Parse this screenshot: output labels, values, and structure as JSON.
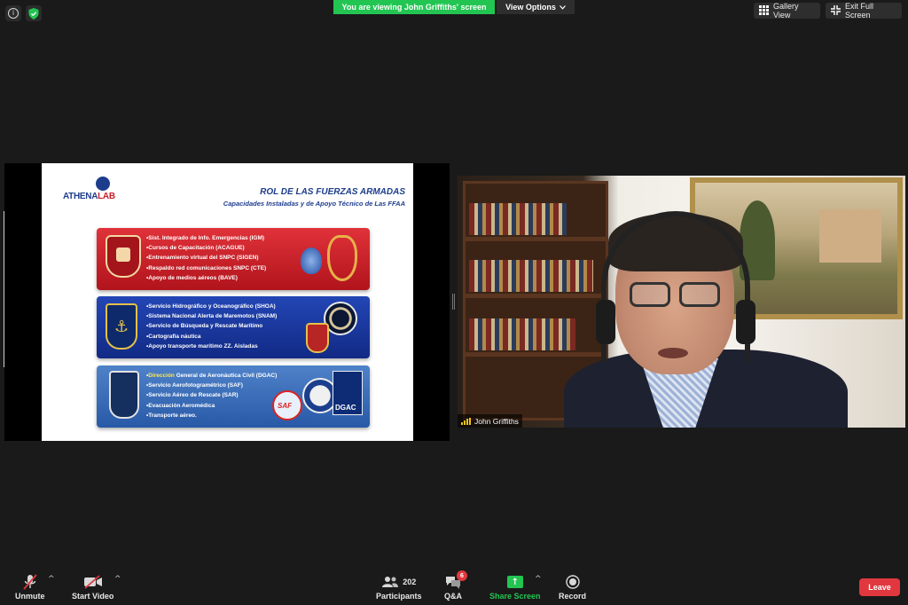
{
  "top_bar": {
    "viewing_banner": "You are viewing John Griffiths' screen",
    "view_options": "View Options",
    "gallery_view": "Gallery View",
    "exit_full_screen": "Exit Full Screen"
  },
  "slide": {
    "logo_text_a": "ATHENA",
    "logo_text_b": "LAB",
    "title": "ROL DE LAS FUERZAS ARMADAS",
    "subtitle": "Capacidades Instaladas y de Apoyo Técnico de Las FFAA",
    "sections": [
      {
        "items": [
          "Sist. Integrado de Info. Emergencias (IGM)",
          "Cursos de Capacitación (ACAGUE)",
          "Entrenamiento virtual del SNPC (SIGEN)",
          "Respaldo red comunicaciones SNPC (CTE)",
          "Apoyo de medios aéreos (BAVE)"
        ]
      },
      {
        "items": [
          "Servicio Hidrográfico y Oceanográfico (SHOA)",
          "Sistema Nacional Alerta de Maremotos (SNAM)",
          "Servicio de Búsqueda y Rescate Marítimo",
          "Cartografía náutica",
          "Apoyo transporte marítimo ZZ. Aisladas"
        ]
      },
      {
        "first_highlight": "Dirección",
        "first_rest": " General de Aeronáutica Civil (DGAC)",
        "items": [
          "Servicio Aerofotogramétrico (SAF)",
          "Servicio Aéreo de Rescate (SAR)",
          "Evacuación Aeromédica",
          "Transporte aéreo."
        ],
        "saf_label": "SAF",
        "dgac_label": "DGAC"
      }
    ]
  },
  "video": {
    "participant_name": "John Griffiths"
  },
  "toolbar": {
    "unmute": "Unmute",
    "start_video": "Start Video",
    "participants_label": "Participants",
    "participants_count": "202",
    "qa_label": "Q&A",
    "qa_badge": "6",
    "share_screen": "Share Screen",
    "record": "Record",
    "leave": "Leave"
  },
  "colors": {
    "banner_green": "#23c552",
    "leave_red": "#e0383e",
    "background": "#1a1a1a"
  }
}
